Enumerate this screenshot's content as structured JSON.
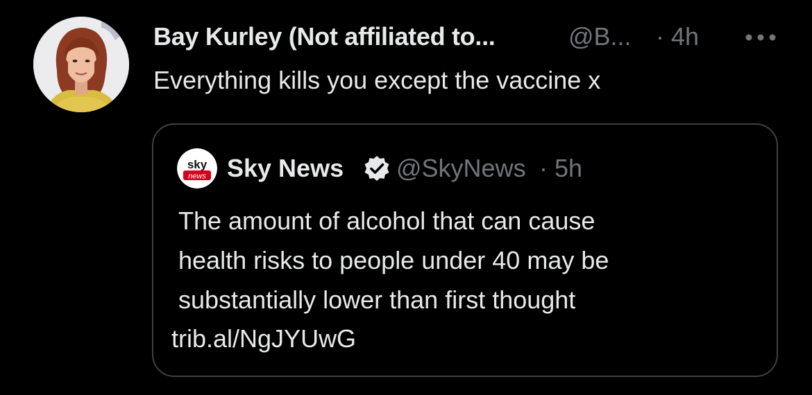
{
  "tweet": {
    "author": {
      "display_name": "Bay Kurley (Not affiliated to...",
      "handle": "@B...",
      "time": "· 4h",
      "avatar_icon": "user-avatar-photo"
    },
    "more_icon": "more-horizontal-icon",
    "text": "Everything kills you except the vaccine x"
  },
  "quote": {
    "author": {
      "display_name": "Sky News",
      "handle": "@SkyNews",
      "time": "· 5h",
      "avatar_icon": "sky-news-logo",
      "logo_text_top": "sky",
      "logo_text_bottom": "news",
      "verified_icon": "verified-badge-icon"
    },
    "text_lines": [
      "The amount of alcohol that can cause",
      "health risks to people under 40 may be",
      "substantially lower than first thought"
    ],
    "link": "trib.al/NgJYUwG"
  },
  "colors": {
    "background": "#000000",
    "primary_text": "#e7e9ea",
    "secondary_text": "#71767b",
    "quote_border": "#3e4144",
    "sky_red": "#d6001c"
  }
}
